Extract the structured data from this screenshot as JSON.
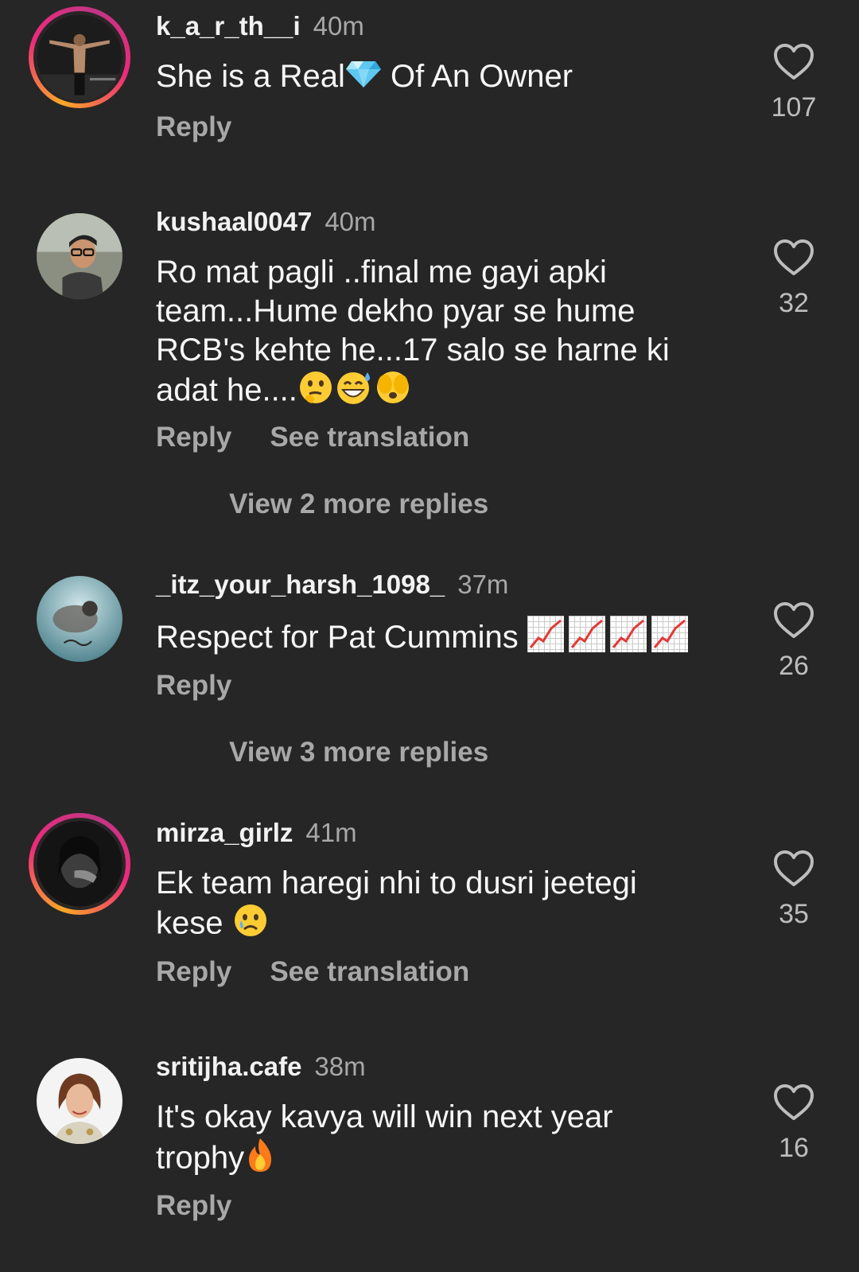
{
  "comments": [
    {
      "username": "k_a_r_th__i",
      "time": "40m",
      "text_before": "She is a Real",
      "text_after": " Of An Owner",
      "inline_icon": "diamond-emoji",
      "actions": [
        "Reply"
      ],
      "likes": "107",
      "avatar_ring": true
    },
    {
      "username": "kushaal0047",
      "time": "40m",
      "text": "Ro mat pagli ..final me gayi apki team...Hume dekho pyar se hume RCB's kehte he...17 salo se harne ki adat he....",
      "emojis": [
        "thinking-face-emoji",
        "grinning-sweat-emoji",
        "face-peeking-emoji"
      ],
      "actions": [
        "Reply",
        "See translation"
      ],
      "more_replies": "View 2 more replies",
      "likes": "32",
      "avatar_ring": false
    },
    {
      "username": "_itz_your_harsh_1098_",
      "time": "37m",
      "text": "Respect for Pat Cummins ",
      "emojis": [
        "chart-increasing-emoji",
        "chart-increasing-emoji",
        "chart-increasing-emoji",
        "chart-increasing-emoji"
      ],
      "actions": [
        "Reply"
      ],
      "more_replies": "View 3 more replies",
      "likes": "26",
      "avatar_ring": false
    },
    {
      "username": "mirza_girlz",
      "time": "41m",
      "text": "Ek team haregi nhi to dusri jeetegi kese ",
      "emojis": [
        "crying-face-emoji"
      ],
      "actions": [
        "Reply",
        "See translation"
      ],
      "likes": "35",
      "avatar_ring": true
    },
    {
      "username": "sritijha.cafe",
      "time": "38m",
      "text": "It's okay kavya will win next year trophy",
      "emojis": [
        "fire-emoji"
      ],
      "actions": [
        "Reply"
      ],
      "likes": "16",
      "avatar_ring": false
    }
  ],
  "colors": {
    "background": "#262626",
    "secondary_text": "#a8a8a8",
    "ring_gradient": [
      "#f9a825",
      "#ee2a7b",
      "#c13584"
    ]
  }
}
